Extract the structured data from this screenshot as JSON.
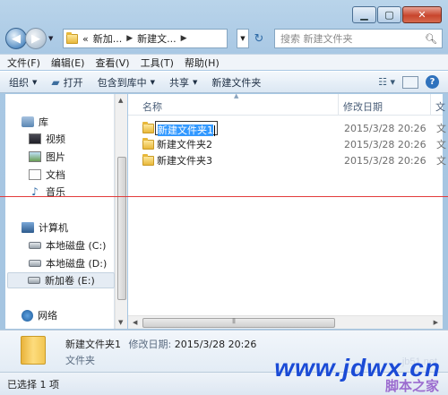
{
  "address": {
    "crumbs": [
      "«",
      "新加...",
      "新建文..."
    ],
    "search_placeholder": "搜索 新建文件夹"
  },
  "menu": [
    "文件(F)",
    "编辑(E)",
    "查看(V)",
    "工具(T)",
    "帮助(H)"
  ],
  "toolbar": {
    "organize": "组织",
    "open": "打开",
    "include": "包含到库中",
    "share": "共享",
    "new_folder": "新建文件夹"
  },
  "nav": {
    "libraries": "库",
    "videos": "视频",
    "pictures": "图片",
    "documents": "文档",
    "music": "音乐",
    "computer": "计算机",
    "drive_c": "本地磁盘 (C:)",
    "drive_d": "本地磁盘 (D:)",
    "drive_e": "新加卷 (E:)",
    "network": "网络"
  },
  "columns": {
    "name": "名称",
    "date": "修改日期",
    "type": "文"
  },
  "files": [
    {
      "name": "新建文件夹1",
      "date": "2015/3/28 20:26",
      "type": "文",
      "renaming": true
    },
    {
      "name": "新建文件夹2",
      "date": "2015/3/28 20:26",
      "type": "文"
    },
    {
      "name": "新建文件夹3",
      "date": "2015/3/28 20:26",
      "type": "文"
    }
  ],
  "details": {
    "name": "新建文件夹1",
    "date_label": "修改日期:",
    "date": "2015/3/28 20:26",
    "type": "文件夹"
  },
  "status": "已选择 1 项",
  "watermark": {
    "main": "www.jdwx.cn",
    "sub": "脚本之家",
    "small": "jb51.net"
  },
  "colors": {
    "selection": "#3399ff",
    "guide_line": "#e23b3b",
    "watermark": "#1b4bd6"
  }
}
